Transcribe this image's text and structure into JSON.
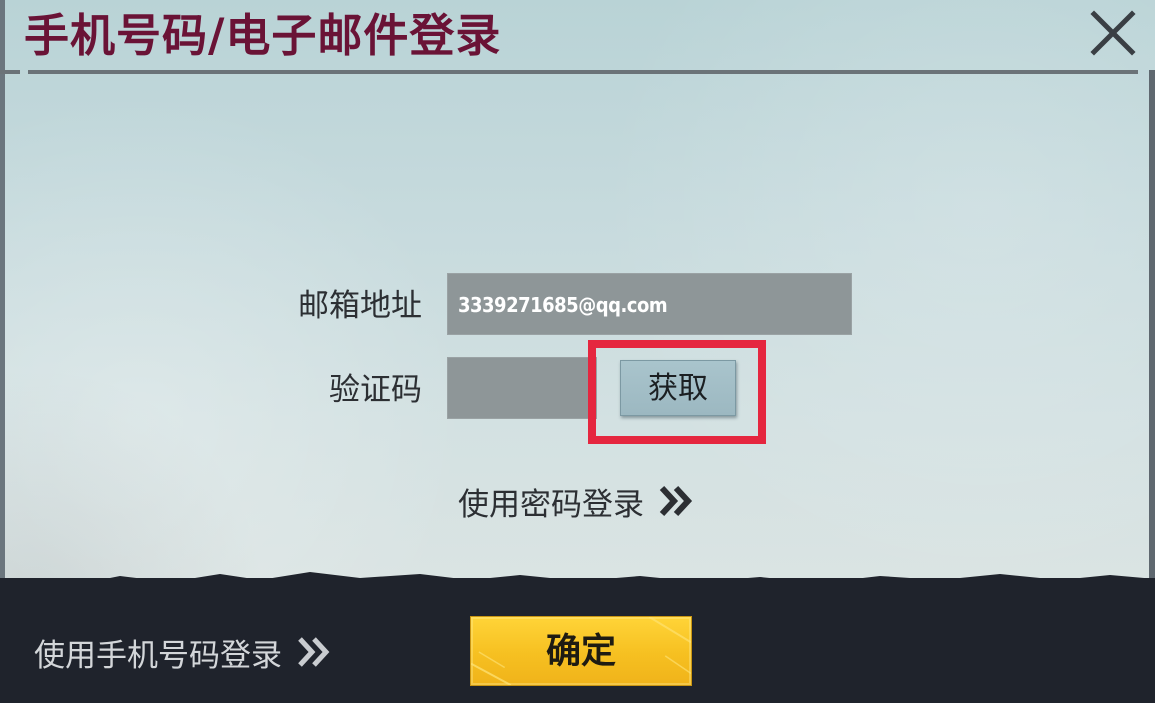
{
  "dialog": {
    "title": "手机号码/电子邮件登录",
    "close_icon": "close-icon"
  },
  "form": {
    "email_label": "邮箱地址",
    "email_value": "3339271685@qq.com",
    "code_label": "验证码",
    "code_value": "",
    "get_code_label": "获取"
  },
  "links": {
    "password_login": "使用密码登录",
    "phone_login": "使用手机号码登录",
    "chevron_icon": "double-chevron-right-icon"
  },
  "footer": {
    "confirm_label": "确定"
  },
  "colors": {
    "title": "#6a1336",
    "highlight_frame": "#e5263f",
    "confirm_button": "#f6c021",
    "footer_bg": "#1f232c"
  }
}
